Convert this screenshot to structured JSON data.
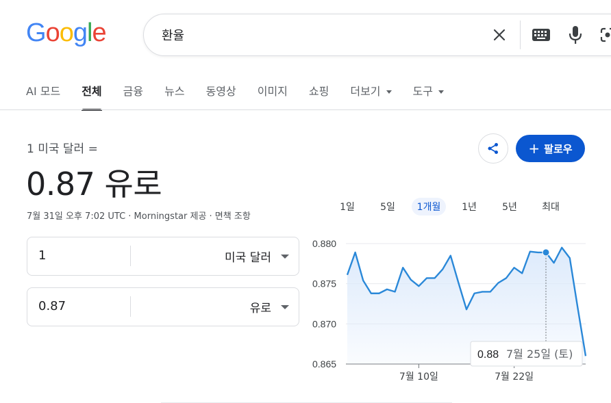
{
  "logo": {
    "letters": [
      "G",
      "o",
      "o",
      "g",
      "l",
      "e"
    ],
    "colors": [
      "#4285f4",
      "#ea4335",
      "#fbbc05",
      "#4285f4",
      "#34a853",
      "#ea4335"
    ]
  },
  "search": {
    "query": "환율",
    "icons": [
      "close-icon",
      "keyboard-icon",
      "mic-icon",
      "lens-icon"
    ]
  },
  "tabs": [
    {
      "label": "AI 모드"
    },
    {
      "label": "전체",
      "active": true
    },
    {
      "label": "금융"
    },
    {
      "label": "뉴스"
    },
    {
      "label": "동영상"
    },
    {
      "label": "이미지"
    },
    {
      "label": "쇼핑"
    },
    {
      "label": "더보기",
      "dropdown": true
    },
    {
      "label": "도구",
      "dropdown": true
    }
  ],
  "currency": {
    "from_label": "1 미국 달러 =",
    "result": "0.87 유로",
    "source": "7월 31일 오후 7:02 UTC · Morningstar 제공 · 면책 조항"
  },
  "actions": {
    "follow_label": "팔로우",
    "share_icon": "share-icon"
  },
  "converter": {
    "from": {
      "value": "1",
      "unit": "미국 달러"
    },
    "to": {
      "value": "0.87",
      "unit": "유로"
    }
  },
  "ranges": [
    {
      "label": "1일"
    },
    {
      "label": "5일"
    },
    {
      "label": "1개월",
      "active": true
    },
    {
      "label": "1년"
    },
    {
      "label": "5년"
    },
    {
      "label": "최대"
    }
  ],
  "colors": {
    "accent": "#0b57d0",
    "line": "#2a88d8",
    "fill": "#dbe9fb"
  },
  "chart_data": {
    "type": "area",
    "title": "",
    "xlabel": "",
    "ylabel": "",
    "ylim": [
      0.865,
      0.88
    ],
    "yticks": [
      "0.880",
      "0.875",
      "0.870",
      "0.865"
    ],
    "xticks": [
      {
        "label": "7월 10일",
        "index": 9
      },
      {
        "label": "7월 22일",
        "index": 21
      }
    ],
    "values": [
      0.8761,
      0.8789,
      0.8754,
      0.8738,
      0.8738,
      0.8743,
      0.874,
      0.877,
      0.8755,
      0.8747,
      0.8757,
      0.8757,
      0.8768,
      0.8785,
      0.8751,
      0.8718,
      0.8738,
      0.874,
      0.874,
      0.8751,
      0.8757,
      0.877,
      0.8763,
      0.879,
      0.8789,
      0.8789,
      0.8776,
      0.8795,
      0.8782,
      0.872,
      0.866
    ],
    "tooltip": {
      "index": 25,
      "value": "0.88",
      "date": "7월 25일 (토)"
    }
  }
}
